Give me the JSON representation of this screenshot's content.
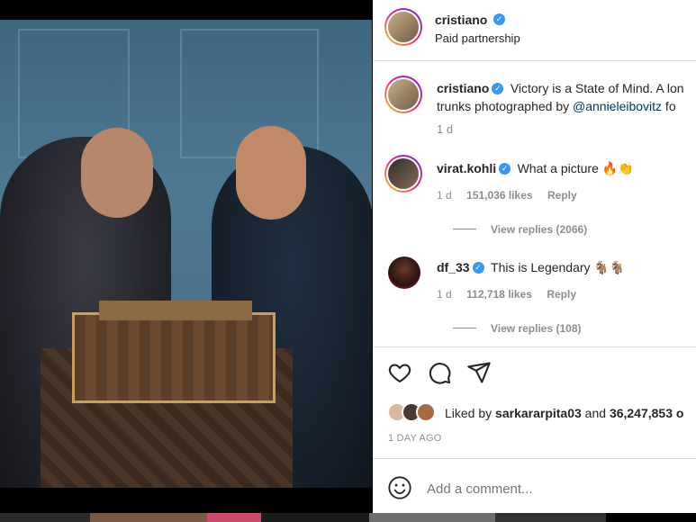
{
  "post": {
    "author": "cristiano",
    "subtitle": "Paid partnership",
    "caption_user": "cristiano",
    "caption_text": "Victory is a State of Mind. A lon",
    "caption_line2_prefix": "trunks photographed by ",
    "caption_mention": "@annieleibovitz",
    "caption_line2_suffix": " fo",
    "caption_time": "1 d"
  },
  "comments": [
    {
      "user": "virat.kohli",
      "text": "What a picture 🔥👏",
      "time": "1 d",
      "likes": "151,036 likes",
      "reply": "Reply",
      "view_replies": "View replies (2066)"
    },
    {
      "user": "df_33",
      "text": "This is Legendary 🐐🐐",
      "time": "1 d",
      "likes": "112,718 likes",
      "reply": "Reply",
      "view_replies": "View replies (108)"
    }
  ],
  "likes": {
    "prefix": "Liked by ",
    "user": "sarkararpita03",
    "middle": " and ",
    "count": "36,247,853 o"
  },
  "timestamp": "1 DAY AGO",
  "add_comment_placeholder": "Add a comment...",
  "colors": {
    "verified": "#3897f0",
    "link": "#00376b",
    "meta": "#8e8e8e"
  }
}
